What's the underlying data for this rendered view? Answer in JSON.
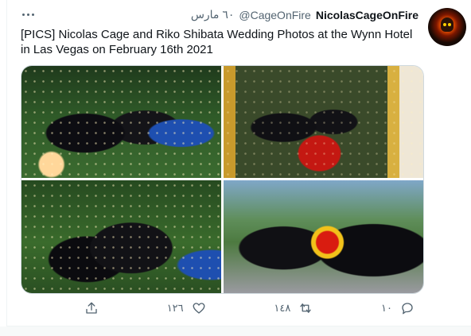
{
  "tweet": {
    "author_name": "NicolasCageOnFire",
    "author_handle": "@CageOnFire",
    "date": "٦٠ مارس",
    "text": "[PICS] Nicolas Cage and Riko Shibata Wedding Photos at the Wynn Hotel in Las Vegas on February 16th 2021",
    "photo_count": 4
  },
  "actions": {
    "reply_count": "١٠",
    "retweet_count": "١٤٨",
    "like_count": "١٢٦"
  },
  "icons": {
    "more": "more-horizontal-icon",
    "reply": "reply-icon",
    "retweet": "retweet-icon",
    "like": "heart-icon",
    "share": "share-icon"
  },
  "colors": {
    "text_primary": "#0f1419",
    "text_secondary": "#536471",
    "border": "#cfd9de"
  }
}
